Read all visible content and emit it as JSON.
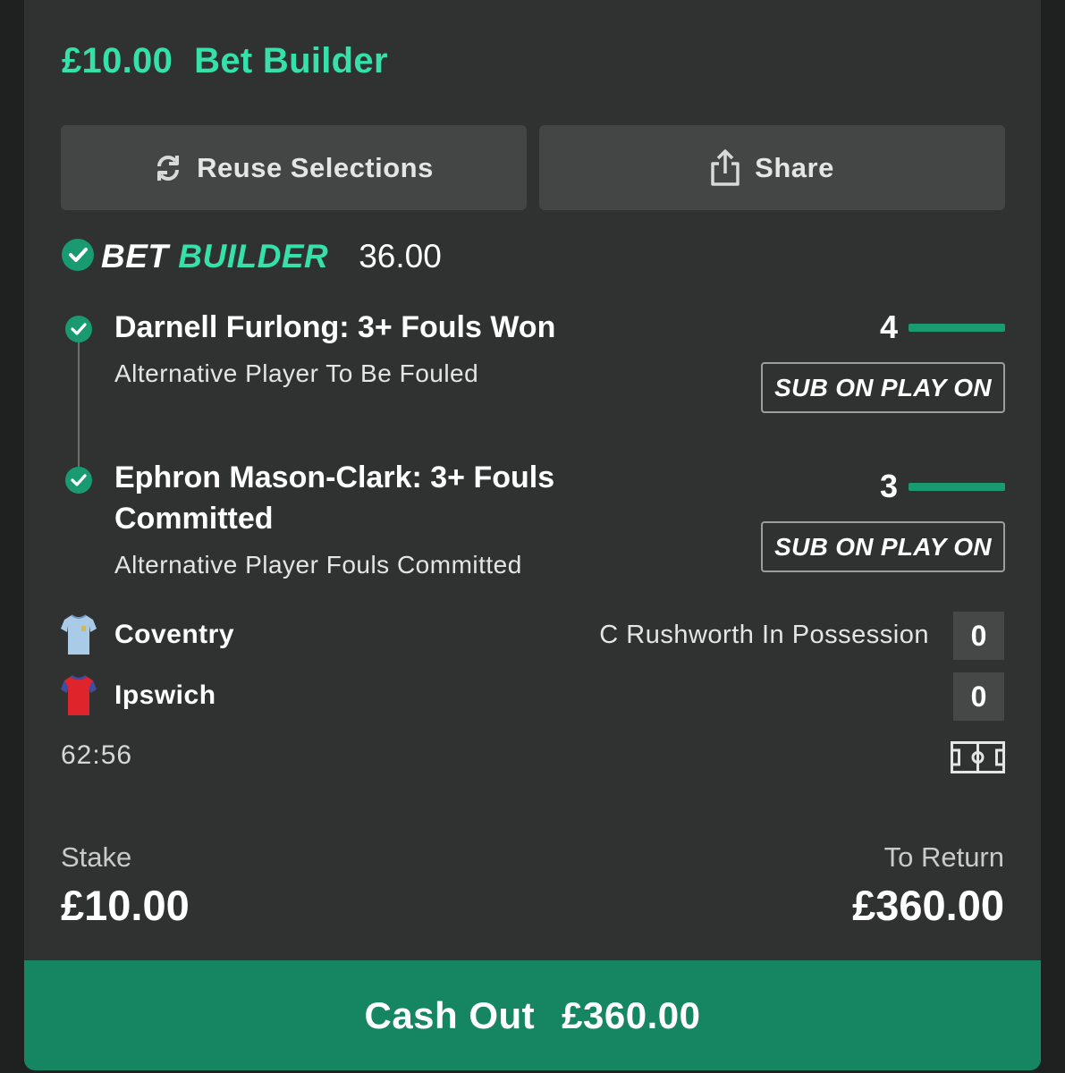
{
  "header": {
    "stake": "£10.00",
    "bet_type": "Bet Builder"
  },
  "actions": {
    "reuse_label": "Reuse Selections",
    "share_label": "Share"
  },
  "bet_builder": {
    "word1": "BET",
    "word2": "BUILDER",
    "odds": "36.00"
  },
  "selections": [
    {
      "title": "Darnell Furlong: 3+ Fouls Won",
      "subtitle": "Alternative Player To Be Fouled",
      "progress_count": "4",
      "progress_fraction": 1.0,
      "badge": "SUB ON PLAY ON"
    },
    {
      "title_line1": "Ephron Mason-Clark: 3+ Fouls",
      "title_line2": "Committed",
      "subtitle": "Alternative Player Fouls Committed",
      "progress_count": "3",
      "progress_fraction": 1.0,
      "badge": "SUB ON PLAY ON"
    }
  ],
  "match": {
    "home": {
      "name": "Coventry",
      "score": "0",
      "kit_color": "#a9cbe8"
    },
    "away": {
      "name": "Ipswich",
      "score": "0",
      "kit_color": "#e0242b"
    },
    "possession_text": "C Rushworth In Possession",
    "clock": "62:56"
  },
  "footer": {
    "stake_label": "Stake",
    "stake_value": "£10.00",
    "return_label": "To Return",
    "return_value": "£360.00"
  },
  "cashout": {
    "label": "Cash Out",
    "amount": "£360.00"
  },
  "colors": {
    "accent": "#35e0a9",
    "cashout_bg": "#168562",
    "progress_fill": "#1a9a71"
  },
  "icons": [
    "refresh-icon",
    "share-icon",
    "check-circle-icon",
    "pitch-icon",
    "kit-icon"
  ]
}
